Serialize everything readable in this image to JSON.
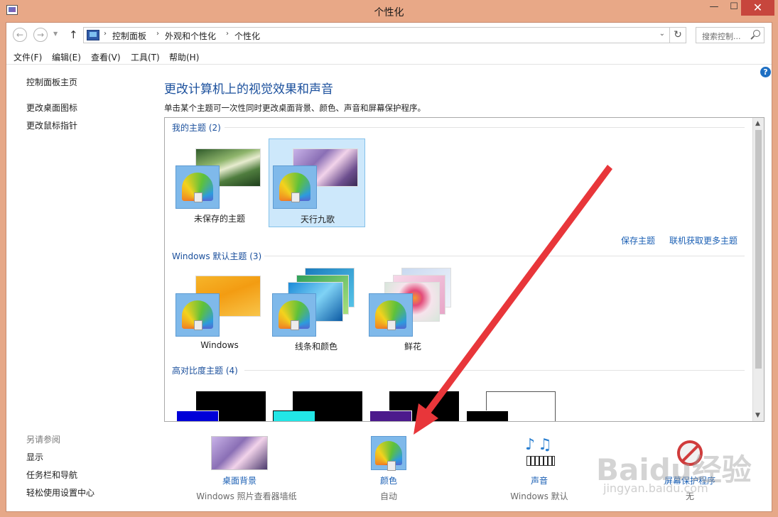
{
  "window": {
    "title": "个性化",
    "minimize": "—",
    "maximize": "☐",
    "close": "✕"
  },
  "nav": {
    "breadcrumbs": [
      "控制面板",
      "外观和个性化",
      "个性化"
    ],
    "search_placeholder": "搜索控制...",
    "back_icon": "←",
    "forward_icon": "→",
    "up_icon": "↑",
    "refresh_icon": "↻",
    "dropdown_icon": "⌄"
  },
  "menu": [
    "文件(F)",
    "编辑(E)",
    "查看(V)",
    "工具(T)",
    "帮助(H)"
  ],
  "sidebar": {
    "links": [
      "控制面板主页",
      "更改桌面图标",
      "更改鼠标指针"
    ],
    "see_also_title": "另请参阅",
    "see_also_links": [
      "显示",
      "任务栏和导航",
      "轻松使用设置中心"
    ]
  },
  "main": {
    "title": "更改计算机上的视觉效果和声音",
    "subtitle": "单击某个主题可一次性同时更改桌面背景、颜色、声音和屏幕保护程序。",
    "help_icon": "?",
    "sections": {
      "my_themes": "我的主题 (2)",
      "default_themes": "Windows 默认主题 (3)",
      "high_contrast": "高对比度主题 (4)"
    },
    "my_themes": [
      "未保存的主题",
      "天行九歌"
    ],
    "default_themes": [
      "Windows",
      "线条和颜色",
      "鲜花"
    ],
    "actions": {
      "save_theme": "保存主题",
      "get_more_online": "联机获取更多主题"
    }
  },
  "bottom": {
    "items": [
      {
        "label": "桌面背景",
        "sub": "Windows 照片查看器墙纸"
      },
      {
        "label": "颜色",
        "sub": "自动"
      },
      {
        "label": "声音",
        "sub": "Windows 默认"
      },
      {
        "label": "屏幕保护程序",
        "sub": "无"
      }
    ]
  },
  "watermark": {
    "main": "Baidu经验",
    "sub": "jingyan.baidu.com"
  },
  "colors": {
    "title_bar": "#e8a887",
    "link_blue": "#1a5fb4",
    "heading_blue": "#1a4f9c",
    "selection": "#cde8fb",
    "close_red": "#c7463d",
    "arrow_red": "#e8363a"
  }
}
